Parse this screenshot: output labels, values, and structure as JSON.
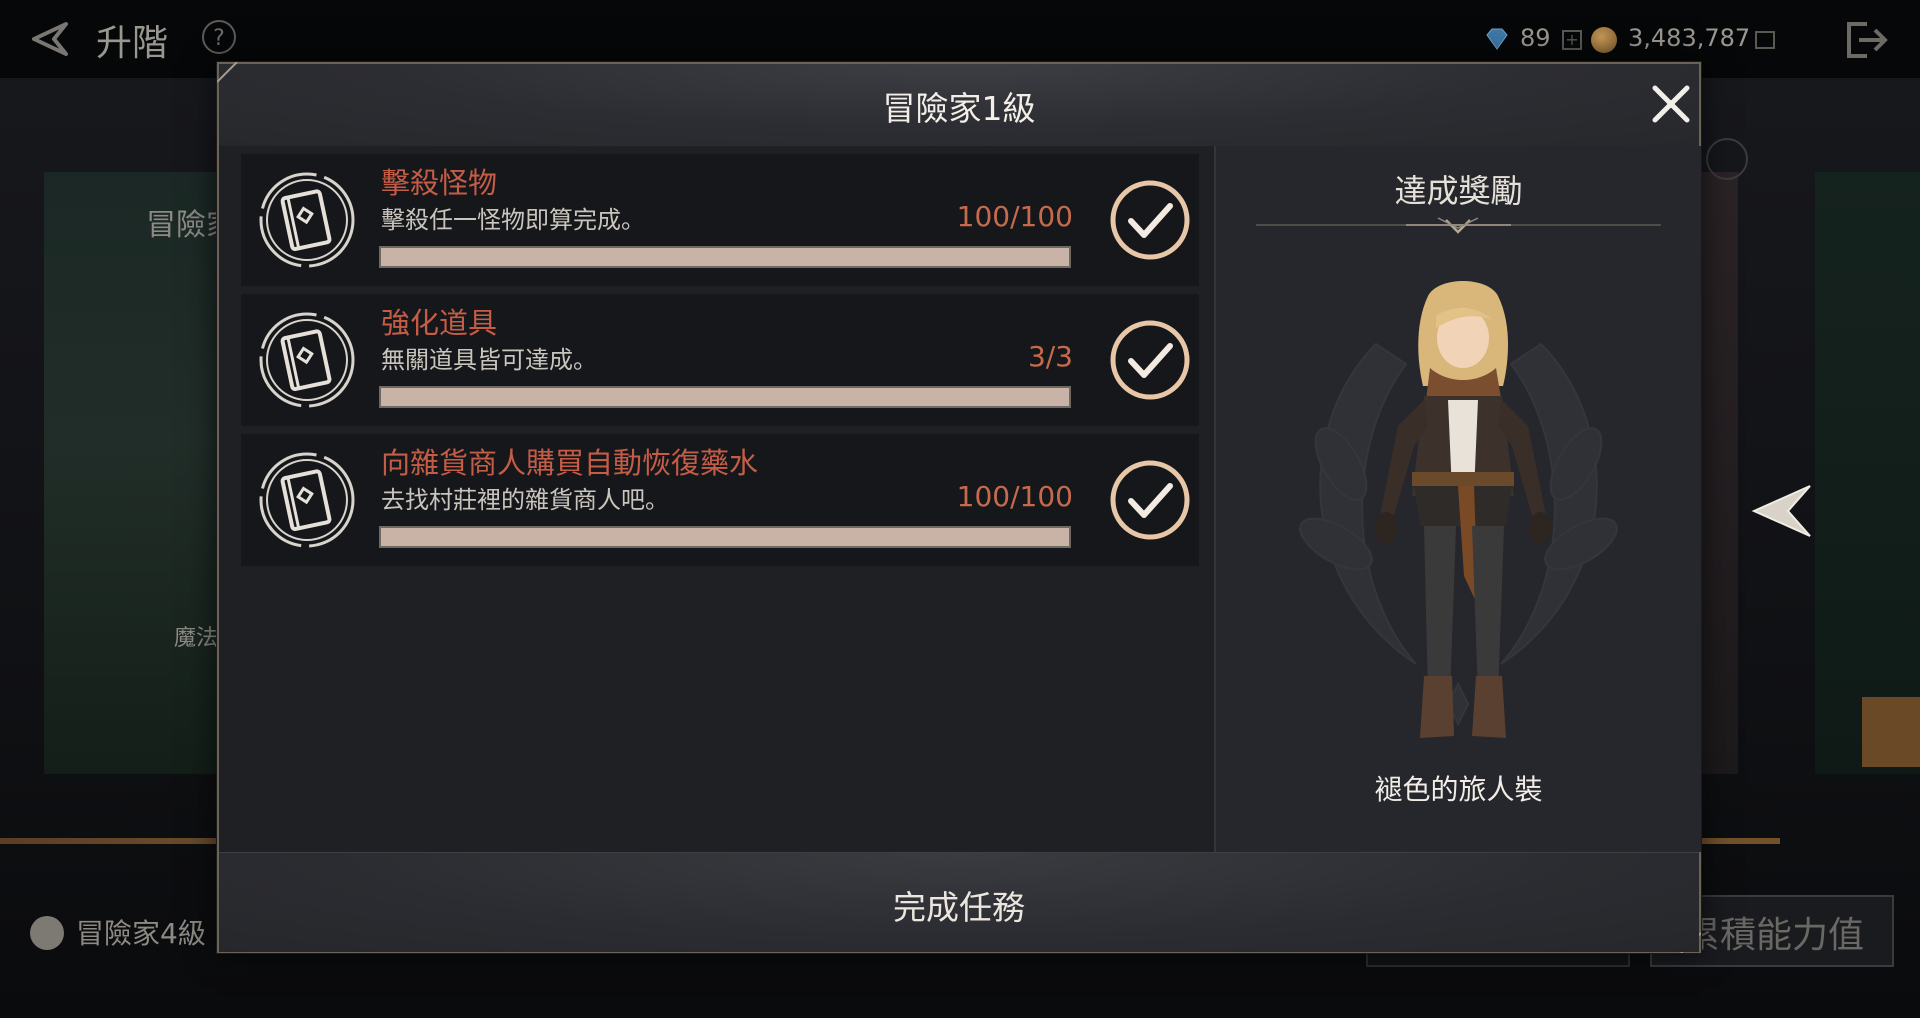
{
  "top_bar": {
    "title": "升階",
    "help_label": "?",
    "gems": "89",
    "gold": "3,483,787"
  },
  "background": {
    "side_text_1": "冒險家",
    "side_text_2": "魔法",
    "bottom_left_label": "冒險家4級",
    "bottom_right_label": "累積能力值"
  },
  "modal": {
    "title": "冒險家1級",
    "quests": [
      {
        "name": "擊殺怪物",
        "description": "擊殺任一怪物即算完成。",
        "progress_text": "100/100",
        "progress": 1.0,
        "completed": true
      },
      {
        "name": "強化道具",
        "description": "無關道具皆可達成。",
        "progress_text": "3/3",
        "progress": 1.0,
        "completed": true
      },
      {
        "name": "向雜貨商人購買自動恢復藥水",
        "description": "去找村莊裡的雜貨商人吧。",
        "progress_text": "100/100",
        "progress": 1.0,
        "completed": true
      }
    ],
    "reward": {
      "title": "達成獎勵",
      "item_name": "褪色的旅人裝"
    },
    "complete_button": "完成任務"
  },
  "colors": {
    "quest_name": "#c55c46",
    "progress_fill": "#c8b3a6",
    "check_ring": "#e8c6a8",
    "frame": "#6b6358"
  }
}
